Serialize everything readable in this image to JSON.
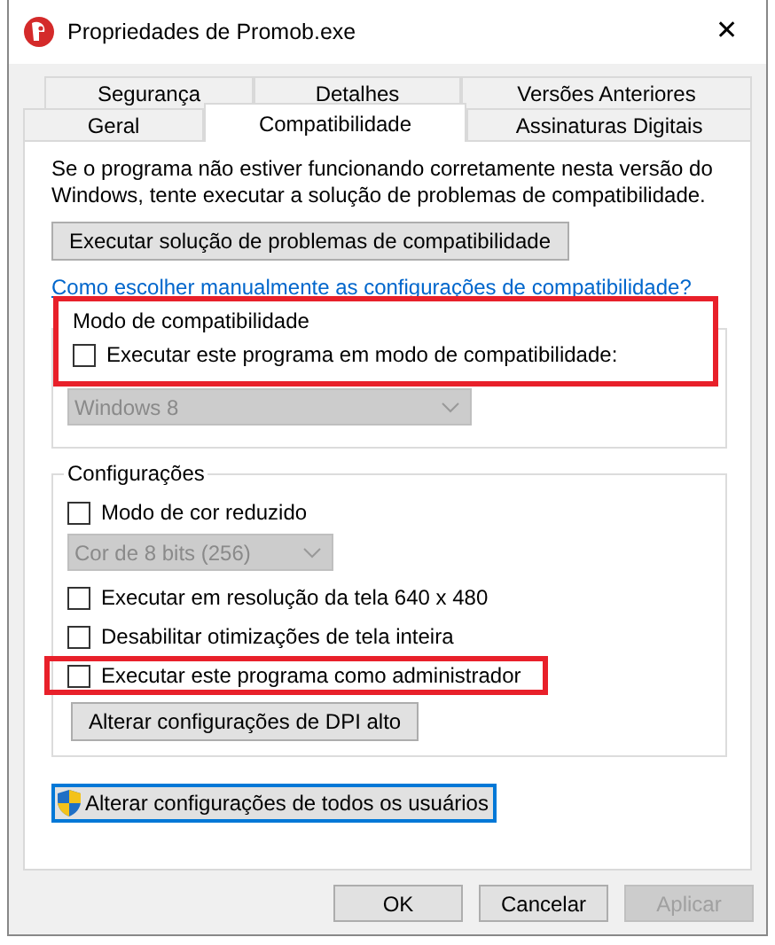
{
  "window": {
    "title": "Propriedades de Promob.exe",
    "close": "✕"
  },
  "tab_rows": [
    [
      {
        "label": "Segurança",
        "selected": false
      },
      {
        "label": "Detalhes",
        "selected": false
      },
      {
        "label": "Versões Anteriores",
        "selected": false
      }
    ],
    [
      {
        "label": "Geral",
        "selected": false
      },
      {
        "label": "Compatibilidade",
        "selected": true
      },
      {
        "label": "Assinaturas Digitais",
        "selected": false
      }
    ]
  ],
  "intro": "Se o programa não estiver funcionando corretamente nesta versão do Windows, tente executar a solução de problemas de compatibilidade.",
  "troubleshoot_button": "Executar solução de problemas de compatibilidade",
  "help_link": "Como escolher manualmente as configurações de compatibilidade?",
  "groups": [
    {
      "title": "Modo de compatibilidade",
      "highlighted": true,
      "items": [
        {
          "kind": "checkbox",
          "label": "Executar este programa em modo de compatibilidade:",
          "checked": false,
          "highlighted": false
        },
        {
          "kind": "dropdown",
          "value": "Windows 8",
          "disabled": true
        }
      ]
    },
    {
      "title": "Configurações",
      "highlighted": false,
      "items": [
        {
          "kind": "checkbox",
          "label": "Modo de cor reduzido",
          "checked": false,
          "highlighted": false
        },
        {
          "kind": "dropdown",
          "value": "Cor de 8 bits (256)",
          "disabled": true
        },
        {
          "kind": "checkbox",
          "label": "Executar em resolução da tela 640 x 480",
          "checked": false,
          "highlighted": false
        },
        {
          "kind": "checkbox",
          "label": "Desabilitar otimizações de tela inteira",
          "checked": false,
          "highlighted": false
        },
        {
          "kind": "checkbox",
          "label": "Executar este programa como administrador",
          "checked": false,
          "highlighted": true
        },
        {
          "kind": "button",
          "label": "Alterar configurações de DPI alto"
        }
      ]
    }
  ],
  "all_users_button": {
    "label": "Alterar configurações de todos os usuários",
    "focused": true
  },
  "dialog_buttons": [
    {
      "label": "OK",
      "disabled": false
    },
    {
      "label": "Cancelar",
      "disabled": false
    },
    {
      "label": "Aplicar",
      "disabled": true
    }
  ]
}
